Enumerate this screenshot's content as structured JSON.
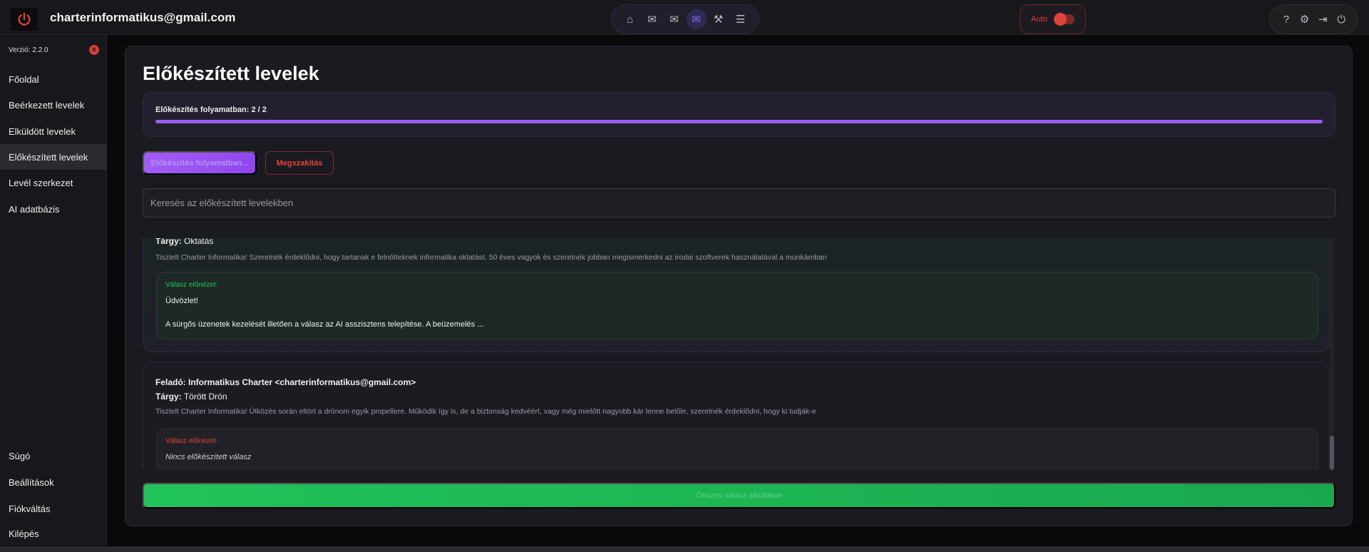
{
  "header": {
    "account_email": "charterinformatikus@gmail.com",
    "nav_icons": [
      "home-icon",
      "mail-icon",
      "mail-check-icon",
      "mail-prepared-icon",
      "tools-icon",
      "database-icon"
    ],
    "active_nav": "mail-prepared-icon",
    "auto_label": "Auto",
    "auto_enabled": false,
    "right_icons": [
      "help-icon",
      "gear-icon",
      "switch-account-icon",
      "power-icon"
    ]
  },
  "sidebar": {
    "version": "Verzió: 2.2.0",
    "items": [
      {
        "label": "Főoldal"
      },
      {
        "label": "Beérkezett levelek"
      },
      {
        "label": "Elküldött levelek"
      },
      {
        "label": "Előkészített levelek"
      },
      {
        "label": "Levél szerkezet"
      },
      {
        "label": "AI adatbázis"
      }
    ],
    "bottom_items": [
      {
        "label": "Súgó"
      },
      {
        "label": "Beállítások"
      },
      {
        "label": "Fiókváltás"
      },
      {
        "label": "Kilépés"
      }
    ]
  },
  "main": {
    "title": "Előkészített levelek",
    "progress": {
      "label": "Előkészítés folyamatban: 2 / 2",
      "done": 2,
      "total": 2
    },
    "prepare_button": "Előkészítés folyamatban...",
    "cancel_button": "Megszakítás",
    "search_placeholder": "Keresés az előkészített levelekben",
    "emails": [
      {
        "subject_label": "Tárgy:",
        "subject": "Oktatás",
        "body": "Tisztelt Charter Informatika! Szeretnék érdeklődni, hogy tartanak e felnőtteknek informatika oktatást. 50 éves vagyok és szeretnék jobban megismerkedni az irodai szoftverek használatával a munkámban",
        "reply_label": "Válasz előnézet:",
        "reply_line1": "Üdvözlet!",
        "reply_line2": "A sürgős üzenetek kezelését illetően a válasz az AI asszisztens telepítése. A beüzemelés ..."
      },
      {
        "from_label": "Feladó:",
        "from": "Informatikus Charter <charterinformatikus@gmail.com>",
        "subject_label": "Tárgy:",
        "subject": "Törött Drón",
        "body": "Tisztelt Charter Informatika! Ütközés során eltört a drónom egyik propellere. Működik így is, de a biztonság kedvéért, vagy még mielőtt nagyobb kár lenne belőle, szeretnék érdeklődni, hogy ki tudják-e",
        "reply_label": "Válasz előnézet:",
        "reply_empty": "Nincs előkészített válasz"
      }
    ],
    "send_all_button": "Összes válasz elküldése"
  },
  "colors": {
    "accent": "#9b5cf0",
    "danger": "#e0443a",
    "success": "#22c25a"
  }
}
